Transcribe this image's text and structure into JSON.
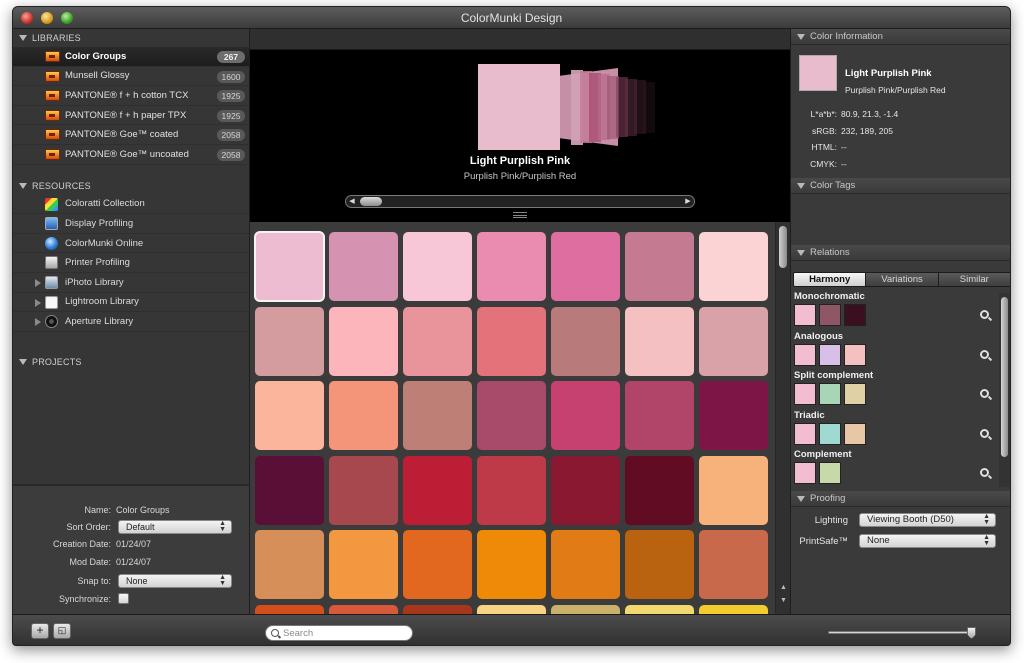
{
  "window": {
    "title": "ColorMunki Design"
  },
  "sidebar": {
    "libraries_header": "LIBRARIES",
    "libraries": [
      {
        "label": "Color Groups",
        "count": "267",
        "selected": true
      },
      {
        "label": "Munsell Glossy",
        "count": "1600"
      },
      {
        "label": "PANTONE® f + h cotton TCX",
        "count": "1925"
      },
      {
        "label": "PANTONE® f + h paper TPX",
        "count": "1925"
      },
      {
        "label": "PANTONE® Goe™ coated",
        "count": "2058"
      },
      {
        "label": "PANTONE® Goe™ uncoated",
        "count": "2058"
      }
    ],
    "resources_header": "RESOURCES",
    "resources": [
      {
        "label": "Coloratti Collection",
        "icon": "coloratti-icon"
      },
      {
        "label": "Display Profiling",
        "icon": "display-icon"
      },
      {
        "label": "ColorMunki Online",
        "icon": "globe-icon"
      },
      {
        "label": "Printer Profiling",
        "icon": "printer-icon"
      },
      {
        "label": "iPhoto Library",
        "icon": "iphoto-icon"
      },
      {
        "label": "Lightroom Library",
        "icon": "lightroom-icon"
      },
      {
        "label": "Aperture Library",
        "icon": "aperture-icon"
      }
    ],
    "projects_header": "PROJECTS"
  },
  "info": {
    "name_label": "Name:",
    "name_value": "Color Groups",
    "sort_label": "Sort Order:",
    "sort_value": "Default",
    "creation_label": "Creation Date:",
    "creation_value": "01/24/07",
    "mod_label": "Mod Date:",
    "mod_value": "01/24/07",
    "snap_label": "Snap to:",
    "snap_value": "None",
    "sync_label": "Synchronize:"
  },
  "preview": {
    "color_name": "Light Purplish Pink",
    "color_family": "Purplish Pink/Purplish Red",
    "main_color": "#e9bccd",
    "fan_colors": [
      "#c58fa6",
      "#d3a1b6",
      "#c57c98",
      "#a84c72",
      "#b86a8c",
      "#9e5572",
      "#7e3c58",
      "#633346",
      "#4a2534",
      "#321a24"
    ]
  },
  "swatches": [
    [
      "#eebcd0",
      "#d693b1",
      "#f7c7d8",
      "#e98caf",
      "#de6ea0",
      "#c47a90",
      "#fcd3d4"
    ],
    [
      "#d49c9f",
      "#fcb5bb",
      "#e9949b",
      "#e3727b",
      "#b97a7c",
      "#f5c0c1",
      "#d9a2a8"
    ],
    [
      "#fbb59c",
      "#f4957a",
      "#bd7f76",
      "#a84b6b",
      "#c6416f",
      "#b14569",
      "#7d1546"
    ],
    [
      "#5a0f37",
      "#a7484f",
      "#bd1e36",
      "#bf3a48",
      "#8a1830",
      "#620c24",
      "#f6b27a"
    ],
    [
      "#d68f58",
      "#f49741",
      "#e1681e",
      "#ef8a09",
      "#e07b15",
      "#b9620f",
      "#c7694a"
    ],
    [
      "#d44e1c",
      "#d8583a",
      "#a8361d",
      "#f6d483",
      "#c9b16b",
      "#f3d870",
      "#f2cc2f"
    ]
  ],
  "color_info": {
    "header": "Color Information",
    "name": "Light Purplish Pink",
    "family": "Purplish Pink/Purplish Red",
    "lab_label": "L*a*b*:",
    "lab_value": "80.9, 21.3, -1.4",
    "srgb_label": "sRGB:",
    "srgb_value": "232, 189, 205",
    "html_label": "HTML:",
    "html_value": "--",
    "cmyk_label": "CMYK:",
    "cmyk_value": "--"
  },
  "color_tags": {
    "header": "Color Tags"
  },
  "relations": {
    "header": "Relations",
    "tabs": [
      "Harmony",
      "Variations",
      "Similar"
    ],
    "groups": [
      {
        "label": "Monochromatic",
        "colors": [
          "#f2bcd1",
          "#8f5666",
          "#3a0f1f"
        ]
      },
      {
        "label": "Analogous",
        "colors": [
          "#f2bcd1",
          "#d8bfe8",
          "#f5c0c0"
        ]
      },
      {
        "label": "Split complement",
        "colors": [
          "#f2bcd1",
          "#a7d5b5",
          "#dfd0a6"
        ]
      },
      {
        "label": "Triadic",
        "colors": [
          "#f2bcd1",
          "#9fdad2",
          "#e8c7a6"
        ]
      },
      {
        "label": "Complement",
        "colors": [
          "#f2bcd1",
          "#c7d9a8"
        ]
      }
    ]
  },
  "proofing": {
    "header": "Proofing",
    "lighting_label": "Lighting",
    "lighting_value": "Viewing Booth (D50)",
    "printsafe_label": "PrintSafe™",
    "printsafe_value": "None"
  },
  "bottom": {
    "search_placeholder": "Search"
  }
}
